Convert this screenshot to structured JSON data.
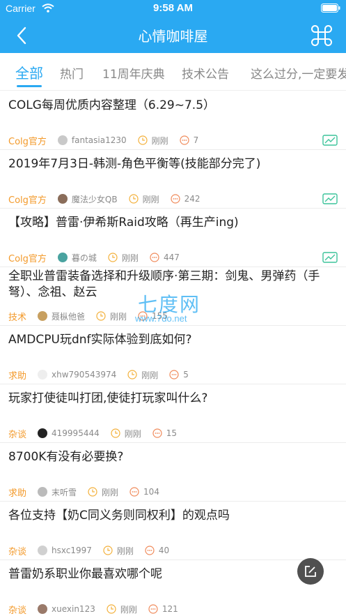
{
  "status_bar": {
    "carrier": "Carrier",
    "time": "9:58 AM"
  },
  "header": {
    "title": "心情咖啡屋",
    "accent": "#2aa9f2"
  },
  "tabs": [
    {
      "label": "全部",
      "active": true
    },
    {
      "label": "热门"
    },
    {
      "label": "11周年庆典"
    },
    {
      "label": "技术公告"
    },
    {
      "label": "这么过分,一定要发"
    }
  ],
  "posts": [
    {
      "title": "COLG每周优质内容整理（6.29~7.5）",
      "tag": "Colg官方",
      "author": "fantasia1230",
      "time": "刚刚",
      "comments": "7",
      "has_image": true
    },
    {
      "title": "2019年7月3日-韩测-角色平衡等(技能部分完了)",
      "tag": "Colg官方",
      "author": "魔法少女QB",
      "time": "刚刚",
      "comments": "242",
      "has_image": true
    },
    {
      "title": "【攻略】普雷·伊希斯Raid攻略（再生产ing)",
      "tag": "Colg官方",
      "author": "暮の城",
      "time": "刚刚",
      "comments": "447",
      "has_image": true
    },
    {
      "title": "全职业普雷装备选择和升级顺序·第三期：剑鬼、男弹药（手弩）、念祖、赵云",
      "tag": "技术",
      "author": "聂枞他爸",
      "time": "刚刚",
      "comments": "155",
      "has_image": false
    },
    {
      "title": "AMDCPU玩dnf实际体验到底如何?",
      "tag": "求助",
      "author": "xhw790543974",
      "time": "刚刚",
      "comments": "5",
      "has_image": false
    },
    {
      "title": "玩家打使徒叫打团,使徒打玩家叫什么?",
      "tag": "杂谈",
      "author": "419995444",
      "time": "刚刚",
      "comments": "15",
      "has_image": false
    },
    {
      "title": "8700K有没有必要换?",
      "tag": "求助",
      "author": "末听雪",
      "time": "刚刚",
      "comments": "104",
      "has_image": false
    },
    {
      "title": "各位支持【奶C同义务则同权利】的观点吗",
      "tag": "杂谈",
      "author": "hsxc1997",
      "time": "刚刚",
      "comments": "40",
      "has_image": false
    },
    {
      "title": "普雷奶系职业你最喜欢哪个呢",
      "tag": "杂谈",
      "author": "xuexin123",
      "time": "刚刚",
      "comments": "121",
      "has_image": false
    }
  ],
  "watermark": {
    "main": "七度网",
    "sub": "www.7do.net"
  }
}
